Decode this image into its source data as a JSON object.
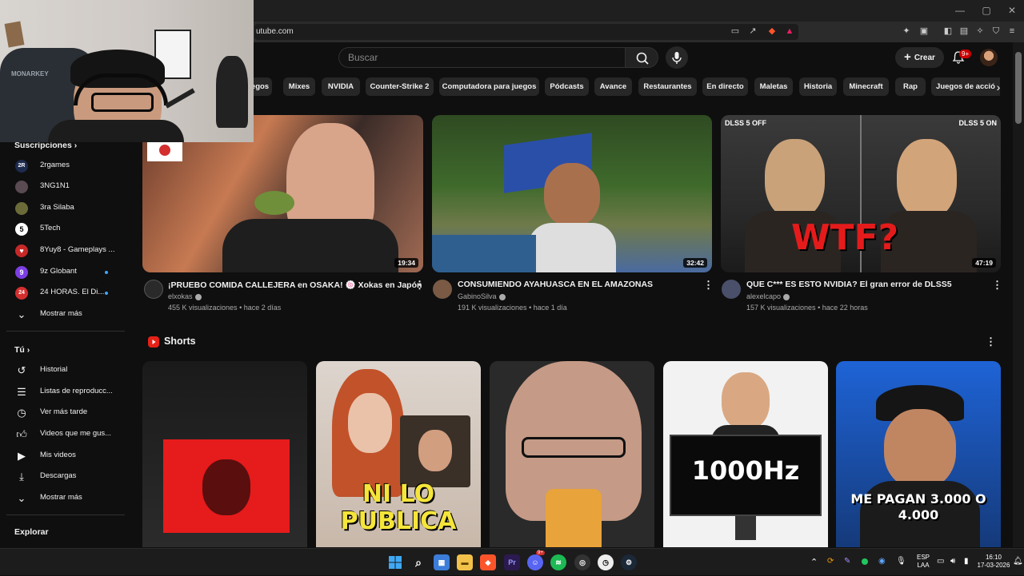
{
  "browser": {
    "url": "utube.com",
    "window_controls": [
      "—",
      "▢",
      "✕"
    ]
  },
  "header": {
    "search_placeholder": "Buscar",
    "create_label": "Crear",
    "notifications_badge": "9+"
  },
  "chips": [
    "egos",
    "Mixes",
    "NVIDIA",
    "Counter-Strike 2",
    "Computadora para juegos",
    "Pódcasts",
    "Avance",
    "Restaurantes",
    "En directo",
    "Maletas",
    "Historia",
    "Minecraft",
    "Rap",
    "Juegos de acció"
  ],
  "sidebar": {
    "subscriptions_title": "Suscripciones",
    "subscriptions": [
      {
        "label": "2rgames",
        "icon": "2R",
        "color": "#1d2b4f",
        "live": false
      },
      {
        "label": "3NG1N1",
        "icon": "3",
        "color": "#5a4a52",
        "live": false
      },
      {
        "label": "3ra Silaba",
        "icon": "3",
        "color": "#6b6b3a",
        "live": false
      },
      {
        "label": "5Tech",
        "icon": "5",
        "color": "#ffffff",
        "live": false
      },
      {
        "label": "8Yuy8 - Gameplays ...",
        "icon": "8",
        "color": "#c62828",
        "live": false
      },
      {
        "label": "9z Globant",
        "icon": "9",
        "color": "#7b3fe4",
        "live": true
      },
      {
        "label": "24 HORAS. El Di...",
        "icon": "24",
        "color": "#d32f2f",
        "live": true
      }
    ],
    "show_more_1": "Mostrar más",
    "you_title": "Tú",
    "you_items": [
      {
        "label": "Historial",
        "icon": "history-icon"
      },
      {
        "label": "Listas de reproducc...",
        "icon": "playlist-icon"
      },
      {
        "label": "Ver más tarde",
        "icon": "clock-icon"
      },
      {
        "label": "Videos que me gus...",
        "icon": "like-icon"
      },
      {
        "label": "Mis videos",
        "icon": "my-videos-icon"
      },
      {
        "label": "Descargas",
        "icon": "download-icon"
      }
    ],
    "show_more_2": "Mostrar más",
    "explore_title": "Explorar"
  },
  "videos": [
    {
      "title": "¡PRUEBO COMIDA CALLEJERA en OSAKA! 🍥 Xokas en Japón",
      "channel": "elxokas",
      "views": "455 K visualizaciones",
      "age": "hace 2 días",
      "duration": "19:34"
    },
    {
      "title": "CONSUMIENDO AYAHUASCA EN EL AMAZONAS",
      "channel": "GabinoSilva",
      "views": "191 K visualizaciones",
      "age": "hace 1 día",
      "duration": "32:42"
    },
    {
      "title": "QUE C*** ES ESTO NVIDIA? El gran error de DLSS5",
      "channel": "alexelcapo",
      "views": "157 K visualizaciones",
      "age": "hace 22 horas",
      "duration": "47:19",
      "overlay_left": "DLSS 5 OFF",
      "overlay_right": "DLSS 5 ON",
      "overlay_big": "WTF?"
    }
  ],
  "shorts": {
    "title": "Shorts",
    "items": [
      {
        "text": ""
      },
      {
        "text": "NI LO PUBLICA"
      },
      {
        "text": ""
      },
      {
        "text": "1000Hz"
      },
      {
        "text": "ME PAGAN 3.000 O 4.000"
      }
    ]
  },
  "taskbar": {
    "lang_top": "ESP",
    "lang_bottom": "LAA",
    "time": "16:10",
    "date": "17-03-2026",
    "discord_badge": "9+"
  }
}
